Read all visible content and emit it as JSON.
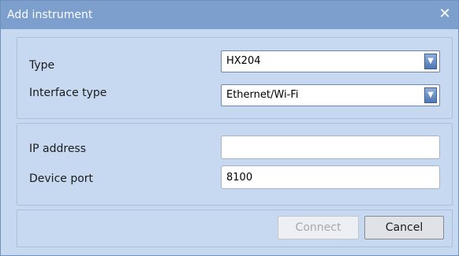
{
  "window": {
    "title": "Add instrument",
    "close_glyph": "✕"
  },
  "instrument_panel": {
    "type_label": "Type",
    "type_value": "HX204",
    "interface_label": "Interface type",
    "interface_value": "Ethernet/Wi-Fi",
    "dropdown_glyph": "▼"
  },
  "network_panel": {
    "ip_label": "IP address",
    "ip_value": "",
    "port_label": "Device port",
    "port_value": "8100"
  },
  "actions": {
    "connect_label": "Connect",
    "connect_enabled": false,
    "cancel_label": "Cancel"
  },
  "colors": {
    "title_bar": "#7c9fcd",
    "panel_bg": "#c7d9f1",
    "dropdown_button": "#4f76b3"
  },
  "icons": {
    "close": "close-icon",
    "dropdown": "chevron-down-icon"
  }
}
